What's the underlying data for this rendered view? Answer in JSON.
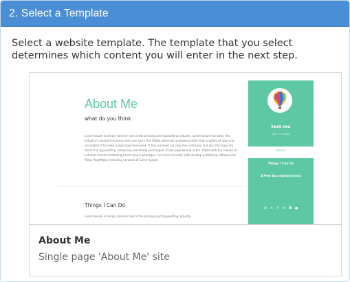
{
  "header": {
    "title": "2. Select a Template"
  },
  "intro": {
    "text": "Select a website template. The template that you select determines which content you will enter in the next step."
  },
  "colors": {
    "header_bg": "#4a8fd6",
    "template_accent": "#5ec7a4"
  },
  "template": {
    "name": "About Me",
    "description": "Single page 'About Me' site",
    "preview": {
      "title": "About Me",
      "subtitle": "what do you think",
      "body": "Lorem Ipsum is simply dummy text of the printing and typesetting industry. Lorem Ipsum has been the industry's standard dummy text ever since the 1500s, when an unknown printer took a galley of type and scrambled it to make a type specimen book. It has survived not only five centuries, but also the leap into electronic typesetting, remaining essentially unchanged. It was popularised in the 1960s with the release of Letraset sheets containing Lorem Ipsum passages, and more recently with desktop publishing software like Aldus PageMaker including versions of Lorem Ipsum.",
      "section_title": "Things I Can Do",
      "section_body": "Lorem Ipsum is simply dummy text of the printing and typesetting industry.",
      "sidebar": {
        "name": "test me",
        "tagline": "test me again",
        "about_link": "About",
        "link_things": "Things I Can Do",
        "link_accomplishments": "A Few Accomplishments",
        "social_icons": [
          "email-icon",
          "twitter-icon",
          "facebook-icon",
          "linkedin-icon",
          "instagram-icon",
          "github-icon"
        ]
      }
    }
  }
}
